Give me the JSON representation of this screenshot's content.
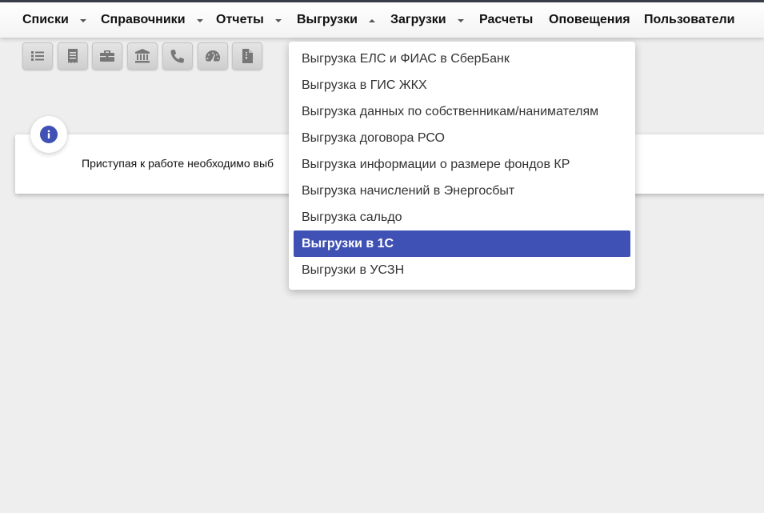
{
  "nav": {
    "items": [
      {
        "label": "Списки"
      },
      {
        "label": "Справочники"
      },
      {
        "label": "Отчеты"
      },
      {
        "label": "Выгрузки"
      },
      {
        "label": "Загрузки"
      },
      {
        "label": "Расчеты"
      },
      {
        "label": "Оповещения"
      },
      {
        "label": "Пользователи"
      }
    ]
  },
  "toolbar": {
    "icons": [
      "list-icon",
      "receipt-icon",
      "briefcase-icon",
      "bank-icon",
      "phone-icon",
      "dashboard-icon",
      "document-icon"
    ]
  },
  "info": {
    "text": "Приступая к работе необходимо выб"
  },
  "dropdown": {
    "items": [
      {
        "label": "Выгрузка ЕЛС и ФИАС в СберБанк"
      },
      {
        "label": "Выгрузка в ГИС ЖКХ"
      },
      {
        "label": "Выгрузка данных по собственникам/нанимателям"
      },
      {
        "label": "Выгрузка договора РСО"
      },
      {
        "label": "Выгрузка информации о размере фондов КР"
      },
      {
        "label": "Выгрузка начислений в Энергосбыт"
      },
      {
        "label": "Выгрузка сальдо"
      },
      {
        "label": "Выгрузки в 1С"
      },
      {
        "label": "Выгрузки в УСЗН"
      }
    ],
    "active_index": 7
  },
  "colors": {
    "accent": "#3f51b5",
    "topline": "#3a3f4b",
    "background": "#eeeeee"
  }
}
